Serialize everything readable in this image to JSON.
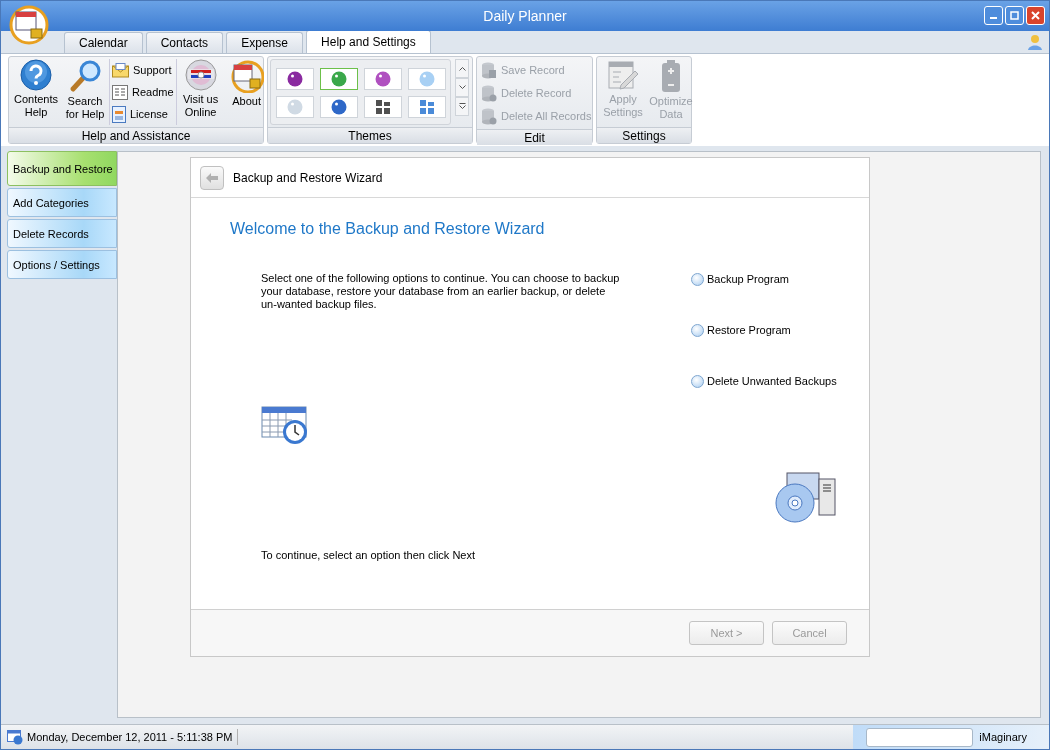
{
  "window": {
    "title": "Daily Planner"
  },
  "tabs": [
    {
      "label": "Calendar",
      "selected": false
    },
    {
      "label": "Contacts",
      "selected": false
    },
    {
      "label": "Expense",
      "selected": false
    },
    {
      "label": "Help and Settings",
      "selected": true
    }
  ],
  "ribbon": {
    "help_group": {
      "label": "Help and Assistance",
      "items": [
        {
          "kind": "large",
          "label": "Contents Help"
        },
        {
          "kind": "large",
          "label": "Search for Help"
        },
        {
          "kind": "stack",
          "entries": [
            {
              "label": "Support"
            },
            {
              "label": "Readme"
            },
            {
              "label": "License"
            }
          ]
        },
        {
          "kind": "large",
          "label": "Visit us Online"
        },
        {
          "kind": "large",
          "label": "About"
        }
      ]
    },
    "themes_group": {
      "label": "Themes",
      "swatches": [
        {
          "kind": "orb",
          "color": "#8a2aa0",
          "selected": false
        },
        {
          "kind": "orb",
          "color": "#3aa84a",
          "selected": true
        },
        {
          "kind": "orb",
          "color": "#b050c0",
          "selected": false
        },
        {
          "kind": "orb",
          "color": "#a8d0f4",
          "selected": false
        },
        {
          "kind": "orb",
          "color": "#d0dae4",
          "selected": false
        },
        {
          "kind": "orb",
          "color": "#2e68c8",
          "selected": false
        },
        {
          "kind": "tiles",
          "color": "#505050",
          "selected": false
        },
        {
          "kind": "tiles",
          "color": "#4a8ad8",
          "selected": false
        }
      ]
    },
    "edit_group": {
      "label": "Edit",
      "items": [
        {
          "label": "Save Record",
          "disabled": true
        },
        {
          "label": "Delete Record",
          "disabled": true
        },
        {
          "label": "Delete All Records",
          "disabled": true
        }
      ]
    },
    "settings_group": {
      "label": "Settings",
      "items": [
        {
          "label": "Apply Settings",
          "disabled": true
        },
        {
          "label": "Optimize Data",
          "disabled": true
        }
      ]
    }
  },
  "sidebar": {
    "items": [
      {
        "label": "Backup and Restore",
        "selected": true
      },
      {
        "label": "Add Categories",
        "selected": false
      },
      {
        "label": "Delete Records",
        "selected": false
      },
      {
        "label": "Options / Settings",
        "selected": false
      }
    ]
  },
  "wizard": {
    "title": "Backup and Restore Wizard",
    "heading": "Welcome to the Backup and Restore Wizard",
    "description": "Select one of the following options to continue. You can choose to backup your database, restore your database from an earlier backup, or delete un-wanted backup files.",
    "options": [
      {
        "label": "Backup Program",
        "selected": false
      },
      {
        "label": "Restore Program",
        "selected": false
      },
      {
        "label": "Delete Unwanted Backups",
        "selected": false
      }
    ],
    "note": "To continue, select an option then click Next",
    "buttons": [
      {
        "label": "Next >",
        "disabled": true
      },
      {
        "label": "Cancel",
        "disabled": true
      }
    ]
  },
  "status_bar": {
    "datetime": "Monday, December 12, 2011 - 5:11:38 PM",
    "brand": "iMaginary"
  }
}
